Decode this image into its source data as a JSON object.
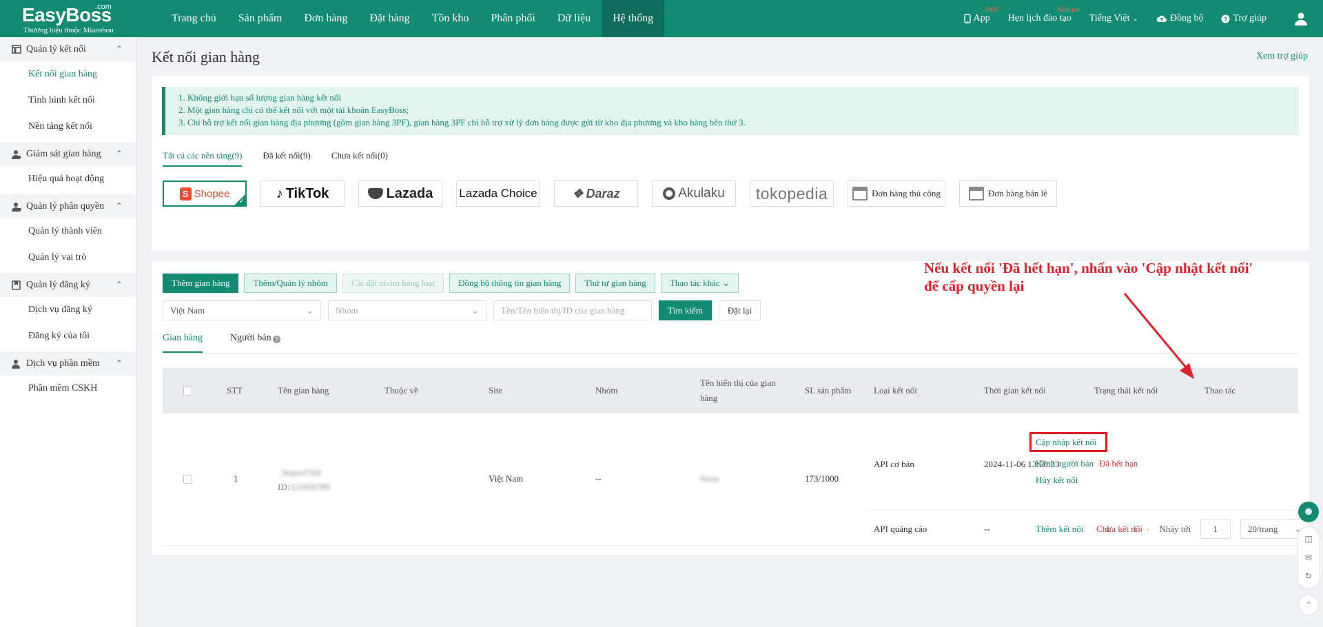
{
  "brand": {
    "name": "EasyBoss",
    "domain_suffix": ".com",
    "tagline": "Thương hiệu thuộc Miaoshou"
  },
  "topnav": {
    "items": [
      "Trang chủ",
      "Sản phẩm",
      "Đơn hàng",
      "Đặt hàng",
      "Tồn kho",
      "Phân phối",
      "Dữ liệu",
      "Hệ thống"
    ],
    "active": "Hệ thống",
    "right": {
      "app": "App",
      "app_badge": "HOT",
      "training": "Hẹn lịch đào tạo",
      "training_badge": "Miễn phí",
      "language": "Tiếng Việt",
      "sync": "Đồng bộ",
      "help": "Trợ giúp"
    }
  },
  "sidebar": {
    "groups": [
      {
        "label": "Quản lý kết nối",
        "icon": "store-icon",
        "items": [
          "Kết nối gian hàng",
          "Tình hình kết nối",
          "Nền tảng kết nối"
        ]
      },
      {
        "label": "Giám sát gian hàng",
        "icon": "user-monitor-icon",
        "items": [
          "Hiệu quả hoạt động"
        ]
      },
      {
        "label": "Quản lý phân quyền",
        "icon": "user-permission-icon",
        "items": [
          "Quản lý thành viên",
          "Quản lý vai trò"
        ]
      },
      {
        "label": "Quản lý đăng ký",
        "icon": "subscription-icon",
        "items": [
          "Dịch vụ đăng ký",
          "Đăng ký của tôi"
        ]
      },
      {
        "label": "Dịch vụ phần mềm",
        "icon": "software-user-icon",
        "items": [
          "Phần mềm CSKH"
        ]
      }
    ],
    "active_item": "Kết nối gian hàng"
  },
  "page": {
    "title": "Kết nối gian hàng",
    "help_link": "Xem trợ giúp",
    "notices": [
      "1. Không giới hạn số lượng gian hàng kết nối",
      "2. Một gian hàng chỉ có thể kết nối với một tài khoản EasyBoss;",
      "3. Chỉ hỗ trợ kết nối gian hàng địa phương (gồm gian hàng 3PF), gian hàng 3PF chỉ hỗ trợ xử lý đơn hàng được gửi từ kho địa phương và kho hàng bên thứ 3."
    ],
    "platform_tabs": [
      "Tất cả các nền tảng(9)",
      "Đã kết nối(9)",
      "Chưa kết nối(0)"
    ],
    "platforms": [
      "Shopee",
      "TikTok",
      "Lazada",
      "Lazada Choice",
      "Daraz",
      "Akulaku",
      "tokopedia",
      "Đơn hàng thủ công",
      "Đơn hàng bán lẻ"
    ],
    "actions": {
      "add_store": "Thêm gian hàng",
      "manage_groups": "Thêm/Quản lý nhóm",
      "bulk_group": "Cài đặt nhóm hàng loạt",
      "sync_info": "Đồng bộ thông tin gian hàng",
      "store_order": "Thứ tự gian hàng",
      "more": "Thao tác khác"
    },
    "filters": {
      "country": "Việt Nam",
      "group_placeholder": "Nhóm",
      "search_placeholder": "Tên/Tên hiển thị/ID của gian hàng",
      "search_btn": "Tìm kiếm",
      "reset_btn": "Đặt lại"
    },
    "subtabs": [
      "Gian hàng",
      "Người bán"
    ],
    "table": {
      "headers": [
        "STT",
        "Tên gian hàng",
        "Thuộc về",
        "Site",
        "Nhóm",
        "Tên hiển thị của gian hàng",
        "SL sản phẩm",
        "Loại kết nối",
        "Thời gian kết nối",
        "Trạng thái kết nối",
        "Thao tác"
      ],
      "row": {
        "stt": "1",
        "store_name": "_lmpovOltd",
        "store_id_label": "ID:",
        "store_id": "123456789",
        "site": "Việt Nam",
        "group": "--",
        "display_name": "Store",
        "product_count": "173/1000",
        "connections": [
          {
            "type": "API cơ bản",
            "time": "2024-11-06 13:50:33",
            "status": "Đã hết hạn",
            "actions": [
              "Cập nhập kết nối",
              "Kênh người bán",
              "Hủy kết nối"
            ]
          },
          {
            "type": "API quảng cáo",
            "time": "--",
            "status": "Chưa kết nối",
            "actions": [
              "Thêm kết nối"
            ]
          }
        ]
      }
    },
    "pagination": {
      "total": "1",
      "current": "1",
      "jump_label": "Nhảy tới",
      "jump_value": "1",
      "page_size": "20/trang"
    }
  },
  "annotation": {
    "line1": "Nếu kết nối 'Đã hết hạn', nhấn vào 'Cập nhật kết nối'",
    "line2": "để cấp quyền lại"
  },
  "colors": {
    "primary": "#138a72",
    "danger": "#e03030",
    "annotation": "#e0202a"
  }
}
